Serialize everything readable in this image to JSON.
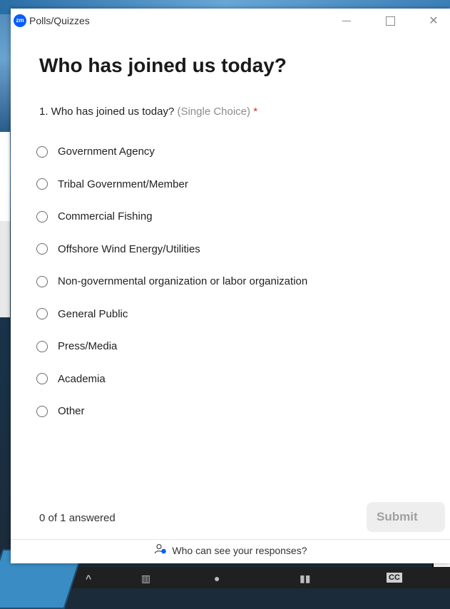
{
  "window": {
    "app_logo_text": "zm",
    "title": "Polls/Quizzes",
    "controls": {
      "minimize_icon": "minimize-icon",
      "maximize_icon": "maximize-icon",
      "close_icon": "close-icon",
      "close_glyph": "✕"
    }
  },
  "poll": {
    "heading": "Who has joined us today?",
    "question": {
      "text": "1. Who has joined us today?",
      "type": "(Single Choice)",
      "required_mark": "*"
    },
    "options": [
      "Government Agency",
      "Tribal Government/Member",
      "Commercial Fishing",
      "Offshore Wind Energy/Utilities",
      "Non-governmental organization or labor organization",
      "General Public",
      "Press/Media",
      "Academia",
      "Other"
    ],
    "progress": "0 of 1 answered",
    "submit_label": "Submit",
    "footer_text": "Who can see your responses?"
  },
  "background": {
    "taskbar_cc_label": "CC"
  },
  "colors": {
    "accent": "#0b5cff",
    "required": "#e02828",
    "submit_disabled_bg": "#eeeeee"
  }
}
